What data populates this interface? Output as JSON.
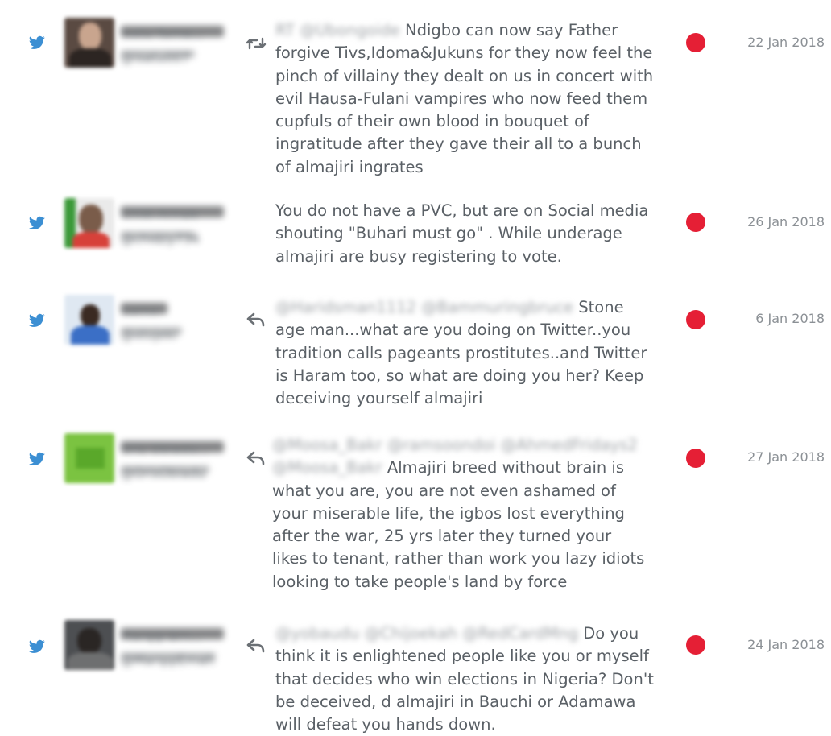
{
  "colors": {
    "twitter_blue": "#3c8fd3",
    "status_red": "#e51f35",
    "text": "#5a6066",
    "date": "#8b9095"
  },
  "rows": [
    {
      "source_icon": "twitter-bird-icon",
      "avatar_blurred": true,
      "user_name": "Isatu Tuma...",
      "user_handle": "@isatu007",
      "action_icon": "retweet-icon",
      "mentions": "RT @Ubongoide",
      "text": "Ndigbo can now say Father forgive Tivs,Idoma&Jukuns for they now feel the pinch of villainy they dealt on us in concert with evil Hausa-Fulani vampires who now feed them cupfuls of their own blood in bouquet of ingratitude after they gave their all to a bunch of almajiri ingrates",
      "date": "22 Jan 2018"
    },
    {
      "source_icon": "twitter-bird-icon",
      "avatar_blurred": true,
      "user_name": "Chidi Arinze",
      "user_handle": "@chidzy734",
      "action_icon": "",
      "mentions": "",
      "text": "You do not have a PVC, but are on Social media shouting \"Buhari must go\" . While underage almajiri are busy registering to vote.",
      "date": "26 Jan 2018"
    },
    {
      "source_icon": "twitter-bird-icon",
      "avatar_blurred": true,
      "user_name": "Camo",
      "user_handle": "@otojeki",
      "action_icon": "reply-icon",
      "mentions": "@Haridsman1112 @Bammuringbruce",
      "text": "Stone age man...what are you doing on Twitter..you tradition calls pageants prostitutes..and Twitter is Haram too, so what are doing you her? Keep deceiving yourself almajiri",
      "date": "6 Jan 2018"
    },
    {
      "source_icon": "twitter-bird-icon",
      "avatar_blurred": true,
      "user_name": "Oris Obiadu...",
      "user_handle": "@OrisObiadu",
      "action_icon": "reply-icon",
      "mentions": "@Moosa_Bakr @ramsoondoi @AhmedFridays2 @Moosa_Bakr",
      "text": "Almajiri breed without brain is what you are, you are not even ashamed of your miserable life, the igbos lost everything after the war, 25 yrs later they turned your likes to tenant, rather than work you lazy idiots looking to take people's land by force",
      "date": "27 Jan 2018"
    },
    {
      "source_icon": "twitter-bird-icon",
      "avatar_blurred": true,
      "user_name": "Marqqi Em...",
      "user_handle": "@MarqqiEmah",
      "action_icon": "reply-icon",
      "mentions": "@yobaudu @Chijoekah @RedCardMng",
      "text": "Do you think it is enlightened people like you or myself that decides who win elections in Nigeria? Don't be deceived, d almajiri in Bauchi or Adamawa will defeat you hands down.",
      "date": "24 Jan 2018"
    }
  ]
}
